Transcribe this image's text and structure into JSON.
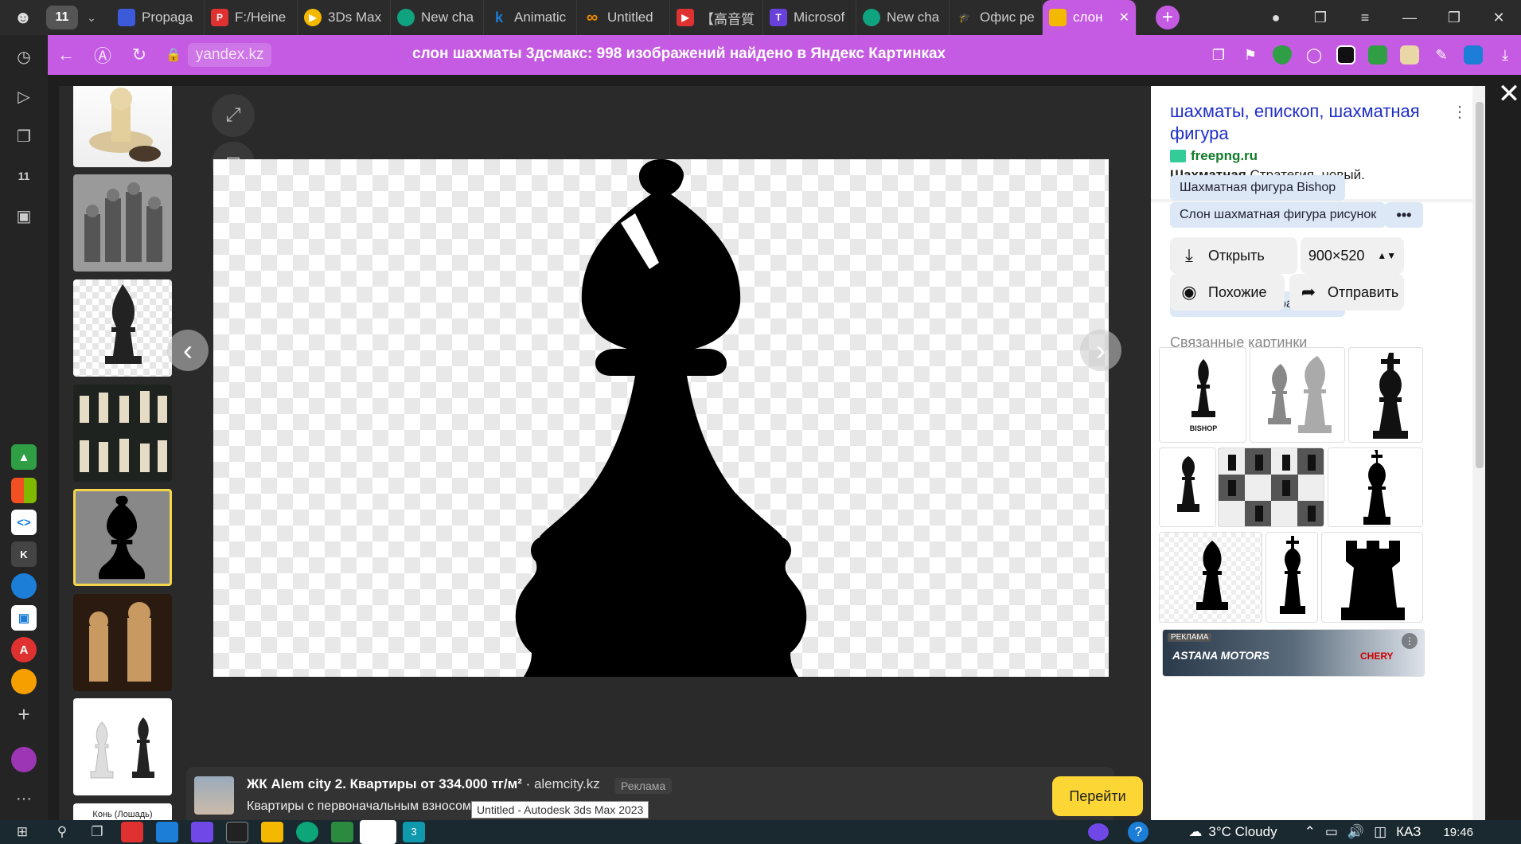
{
  "tabbar": {
    "tab_count": "11",
    "tabs": [
      {
        "label": "Propaga",
        "icon_color": "#3b5bdb"
      },
      {
        "label": "F:/Heine",
        "icon_color": "#e03131"
      },
      {
        "label": "3Ds Max",
        "icon_color": "#f5b800"
      },
      {
        "label": "New cha",
        "icon_color": "#10a37f"
      },
      {
        "label": "Animatic",
        "icon_color": "#1c7ed6"
      },
      {
        "label": "Untitled",
        "icon_color": "#f08c00"
      },
      {
        "label": "【高音質",
        "icon_color": "#e03131"
      },
      {
        "label": "Microsof",
        "icon_color": "#6741d9"
      },
      {
        "label": "New cha",
        "icon_color": "#10a37f"
      },
      {
        "label": "Офис ре",
        "icon_color": "#666666"
      },
      {
        "label": "слон",
        "icon_color": "#f5b800"
      }
    ],
    "active_tab_color": "#c55be3"
  },
  "addressbar": {
    "domain": "yandex.kz",
    "page_title": "слон шахматы 3дсмакс: 998 изображений найдено в Яндекс Картинках"
  },
  "viewer": {
    "ad": {
      "title": "ЖК Alem city 2. Квартиры от 334.000 тг/м²",
      "site": "alemcity.kz",
      "label": "Реклама",
      "subtitle": "Квартиры с первоначальным взносом от 5.0…  ЖК на …  4 200 мест",
      "button": "Перейти"
    },
    "thumb_caption": "Конь (Лошадь)"
  },
  "tooltip": "Untitled - Autodesk 3ds Max 2023",
  "panel": {
    "title": "шахматы, епископ, шахматная фигура",
    "source": "freepng.ru",
    "desc_bold": "Шахматная",
    "desc_rest": " Стратегия. новый.",
    "chips": [
      "Шахматная фигура Bishop",
      "Слон шахматная фигура рисунок"
    ],
    "chip_more": "•••",
    "open_label": "Открыть",
    "size": "900×520",
    "similar_label": "Похожие",
    "share_label": "Отправить",
    "related_heading": "Связанные картинки",
    "related_caption": "BISHOP",
    "ad_tag": "РЕКЛАМА",
    "ad_brand1": "ASTANA MOTORS",
    "ad_brand2": "CHERY"
  },
  "taskbar": {
    "weather": "3°C  Cloudy",
    "lang": "КАЗ",
    "time": "19:46",
    "app_badge": "3"
  }
}
